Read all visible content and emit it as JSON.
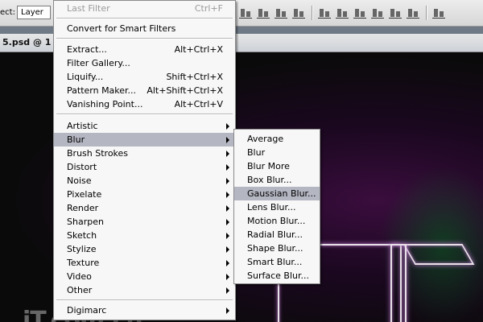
{
  "options_bar": {
    "select_label": "ect:",
    "select_value": "Layer",
    "align_icons": [
      "align-top-edges-icon",
      "align-vertical-centers-icon",
      "align-bottom-edges-icon",
      "align-left-edges-icon",
      "align-horizontal-centers-icon",
      "align-right-edges-icon",
      "distribute-top-icon",
      "distribute-vertical-centers-icon",
      "distribute-bottom-icon",
      "distribute-left-icon",
      "distribute-horizontal-centers-icon",
      "distribute-right-icon",
      "auto-align-icon"
    ]
  },
  "document": {
    "tab_title": "5.psd @ 1"
  },
  "filter_menu": {
    "group1": [
      {
        "label": "Last Filter",
        "shortcut": "Ctrl+F",
        "disabled": true
      }
    ],
    "group2": [
      {
        "label": "Convert for Smart Filters",
        "shortcut": ""
      }
    ],
    "group3": [
      {
        "label": "Extract...",
        "shortcut": "Alt+Ctrl+X"
      },
      {
        "label": "Filter Gallery...",
        "shortcut": ""
      },
      {
        "label": "Liquify...",
        "shortcut": "Shift+Ctrl+X"
      },
      {
        "label": "Pattern Maker...",
        "shortcut": "Alt+Shift+Ctrl+X"
      },
      {
        "label": "Vanishing Point...",
        "shortcut": "Alt+Ctrl+V"
      }
    ],
    "group4": [
      {
        "label": "Artistic"
      },
      {
        "label": "Blur",
        "highlighted": true
      },
      {
        "label": "Brush Strokes"
      },
      {
        "label": "Distort"
      },
      {
        "label": "Noise"
      },
      {
        "label": "Pixelate"
      },
      {
        "label": "Render"
      },
      {
        "label": "Sharpen"
      },
      {
        "label": "Sketch"
      },
      {
        "label": "Stylize"
      },
      {
        "label": "Texture"
      },
      {
        "label": "Video"
      },
      {
        "label": "Other"
      }
    ],
    "group5": [
      {
        "label": "Digimarc"
      }
    ]
  },
  "blur_submenu": [
    {
      "label": "Average"
    },
    {
      "label": "Blur"
    },
    {
      "label": "Blur More"
    },
    {
      "label": "Box Blur..."
    },
    {
      "label": "Gaussian Blur...",
      "highlighted": true
    },
    {
      "label": "Lens Blur..."
    },
    {
      "label": "Motion Blur..."
    },
    {
      "label": "Radial Blur..."
    },
    {
      "label": "Shape Blur..."
    },
    {
      "label": "Smart Blur..."
    },
    {
      "label": "Surface Blur..."
    }
  ],
  "watermark": "iT.com.cn",
  "colors": {
    "menu_highlight": "#b4b6c2",
    "canvas_purple": "#3a0d3d",
    "glow": "#b070c0"
  }
}
